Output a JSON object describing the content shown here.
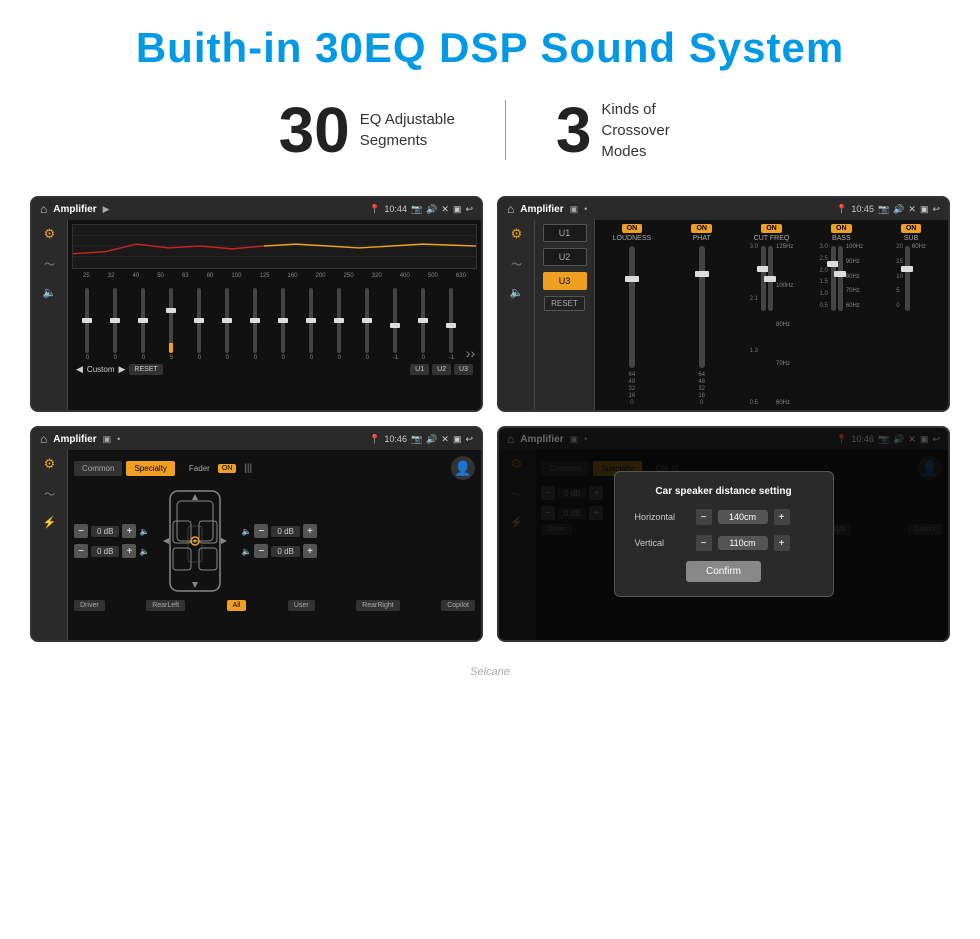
{
  "header": {
    "title": "Buith-in 30EQ DSP Sound System"
  },
  "stats": [
    {
      "number": "30",
      "desc": "EQ Adjustable\nSegments"
    },
    {
      "number": "3",
      "desc": "Kinds of\nCrossover Modes"
    }
  ],
  "screens": [
    {
      "id": "eq-screen",
      "status": {
        "time": "10:44",
        "app": "Amplifier"
      },
      "type": "eq"
    },
    {
      "id": "crossover-screen",
      "status": {
        "time": "10:45",
        "app": "Amplifier"
      },
      "type": "crossover"
    },
    {
      "id": "balance-screen",
      "status": {
        "time": "10:46",
        "app": "Amplifier"
      },
      "type": "balance"
    },
    {
      "id": "distance-screen",
      "status": {
        "time": "10:46",
        "app": "Amplifier"
      },
      "type": "distance-dialog"
    }
  ],
  "eq": {
    "frequencies": [
      "25",
      "32",
      "40",
      "50",
      "63",
      "80",
      "100",
      "125",
      "160",
      "200",
      "250",
      "320",
      "400",
      "500",
      "630"
    ],
    "values": [
      "0",
      "0",
      "0",
      "5",
      "0",
      "0",
      "0",
      "0",
      "0",
      "0",
      "0",
      "-1",
      "0",
      "-1"
    ],
    "preset": "Custom",
    "buttons": [
      "RESET",
      "U1",
      "U2",
      "U3"
    ]
  },
  "crossover": {
    "presets": [
      "U1",
      "U2",
      "U3"
    ],
    "active_preset": "U3",
    "channels": [
      "LOUDNESS",
      "PHAT",
      "CUT FREQ",
      "BASS",
      "SUB"
    ],
    "reset_label": "RESET"
  },
  "balance": {
    "tabs": [
      "Common",
      "Specialty"
    ],
    "active_tab": "Specialty",
    "fader_label": "Fader",
    "fader_on": "ON",
    "db_values": [
      "0 dB",
      "0 dB",
      "0 dB",
      "0 dB"
    ],
    "bottom_buttons": [
      "Driver",
      "RearLeft",
      "All",
      "User",
      "RearRight",
      "Copilot"
    ],
    "active_bottom": "All"
  },
  "distance_dialog": {
    "title": "Car speaker distance setting",
    "horizontal_label": "Horizontal",
    "horizontal_value": "140cm",
    "vertical_label": "Vertical",
    "vertical_value": "110cm",
    "confirm_label": "Confirm"
  },
  "watermark": "Seicane"
}
